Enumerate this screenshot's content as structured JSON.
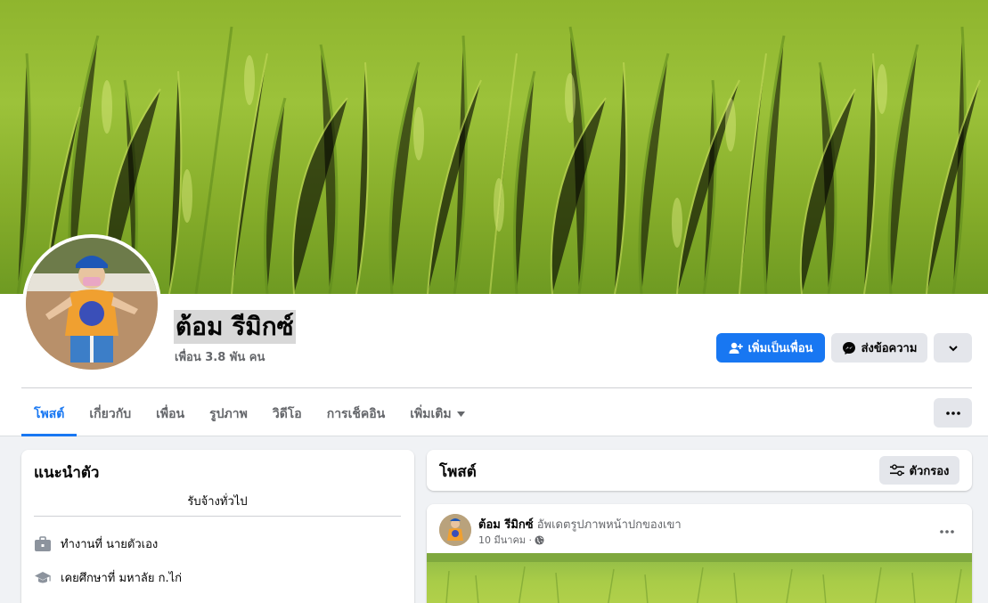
{
  "profile": {
    "name": "ต้อม รีมิกซ์",
    "friends": "เพื่อน 3.8 พัน คน"
  },
  "actions": {
    "add_friend": "เพิ่มเป็นเพื่อน",
    "message": "ส่งข้อความ"
  },
  "tabs": [
    {
      "label": "โพสต์",
      "active": true
    },
    {
      "label": "เกี่ยวกับ"
    },
    {
      "label": "เพื่อน"
    },
    {
      "label": "รูปภาพ"
    },
    {
      "label": "วิดีโอ"
    },
    {
      "label": "การเช็คอิน"
    },
    {
      "label": "เพิ่มเติม"
    }
  ],
  "intro": {
    "title": "แนะนำตัว",
    "bio": "รับจ้างทั่วไป",
    "items": [
      {
        "icon": "briefcase-icon",
        "text": "ทำงานที่ นายตัวเอง"
      },
      {
        "icon": "graduation-cap-icon",
        "text": "เคยศึกษาที่ มหาลัย ก.ไก่"
      }
    ]
  },
  "posts": {
    "title": "โพสต์",
    "filter_label": "ตัวกรอง"
  },
  "post": {
    "author": "ต้อม รีมิกซ์",
    "action": "อัพเดตรูปภาพหน้าปกของเขา",
    "time": "10 มีนาคม ·"
  },
  "colors": {
    "accent": "#1877f2",
    "background": "#f0f2f5",
    "button_gray": "#e4e6eb"
  }
}
